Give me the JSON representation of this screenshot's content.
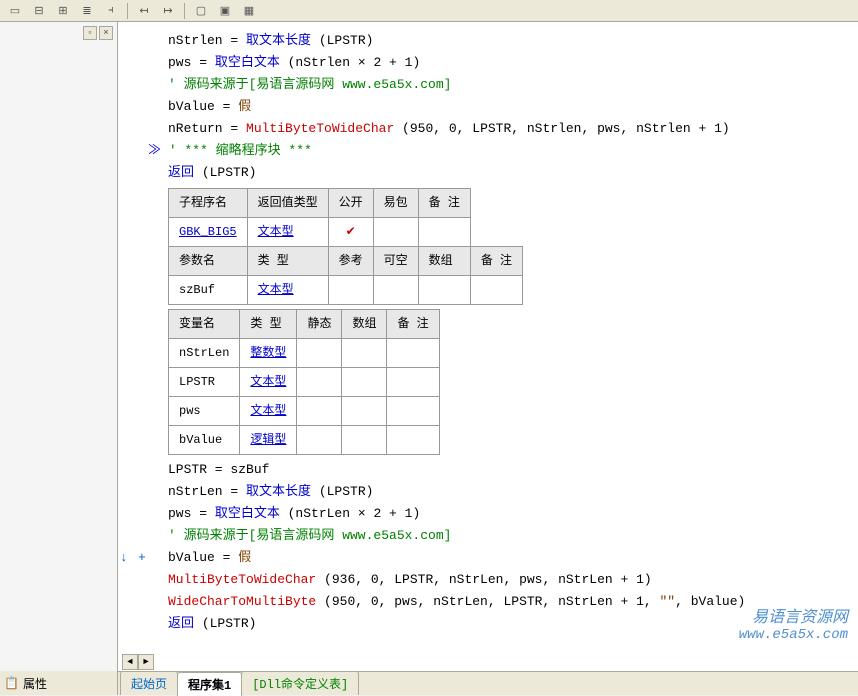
{
  "toolbar": {
    "icons": [
      "align-left",
      "align-center",
      "align-right",
      "list",
      "outdent",
      "indent",
      "spacer",
      "block1",
      "block2",
      "block3"
    ]
  },
  "left_panel": {
    "prop_tab": "属性"
  },
  "code": {
    "line1_var": "nStrlen",
    "line1_eq": " = ",
    "line1_func": "取文本长度",
    "line1_arg": " (LPSTR)",
    "line2_var": "pws",
    "line2_eq": " = ",
    "line2_func": "取空白文本",
    "line2_arg": " (nStrlen × 2 + 1)",
    "line3_comment": "' 源码来源于[易语言源码网 www.e5a5x.com]",
    "line4_var": "bValue",
    "line4_eq": " = ",
    "line4_val": "假",
    "line5_var": "nReturn",
    "line5_eq": " = ",
    "line5_func": "MultiByteToWideChar",
    "line5_arg": " (950, 0, LPSTR, nStrlen, pws, nStrlen + 1)",
    "line6_marker": "≫",
    "line6_comment": "' *** 缩略程序块 ***",
    "line7_func": "返回",
    "line7_arg": " (LPSTR)",
    "line_lpstr": "LPSTR = szBuf",
    "line_nstrlen_var": "nStrLen",
    "line_nstrlen_eq": " = ",
    "line_nstrlen_func": "取文本长度",
    "line_nstrlen_arg": " (LPSTR)",
    "line_pws_var": "pws",
    "line_pws_eq": " = ",
    "line_pws_func": "取空白文本",
    "line_pws_arg": " (nStrLen × 2 + 1)",
    "line_comment2": "' 源码来源于[易语言源码网 www.e5a5x.com]",
    "line_bvalue_var": "bValue",
    "line_bvalue_eq": " = ",
    "line_bvalue_val": "假",
    "line_mbtwc": "MultiByteToWideChar",
    "line_mbtwc_arg": " (936, 0, LPSTR, nStrLen, pws, nStrLen + 1)",
    "line_wctmb": "WideCharToMultiByte",
    "line_wctmb_arg1": " (950, 0, pws, nStrLen, LPSTR, nStrLen + 1, ",
    "line_wctmb_str": "\"\"",
    "line_wctmb_arg2": ", bValue)",
    "line_ret": "返回",
    "line_ret_arg": " (LPSTR)",
    "arrow_down": "↓",
    "plus": "+"
  },
  "table1": {
    "headers": [
      "子程序名",
      "返回值类型",
      "公开",
      "易包",
      "备 注"
    ],
    "row1": [
      "GBK_BIG5",
      "文本型",
      "✔",
      "",
      ""
    ],
    "headers2": [
      "参数名",
      "类 型",
      "参考",
      "可空",
      "数组",
      "备 注"
    ],
    "row2": [
      "szBuf",
      "文本型",
      "",
      "",
      "",
      ""
    ]
  },
  "table2": {
    "headers": [
      "变量名",
      "类 型",
      "静态",
      "数组",
      "备 注"
    ],
    "rows": [
      [
        "nStrLen",
        "整数型",
        "",
        "",
        ""
      ],
      [
        "LPSTR",
        "文本型",
        "",
        "",
        ""
      ],
      [
        "pws",
        "文本型",
        "",
        "",
        ""
      ],
      [
        "bValue",
        "逻辑型",
        "",
        "",
        ""
      ]
    ]
  },
  "tabs": {
    "tab1": "起始页",
    "tab2": "程序集1",
    "tab3": "[Dll命令定义表]"
  },
  "watermark": {
    "cn": "易语言资源网",
    "url": "www.e5a5x.com"
  }
}
